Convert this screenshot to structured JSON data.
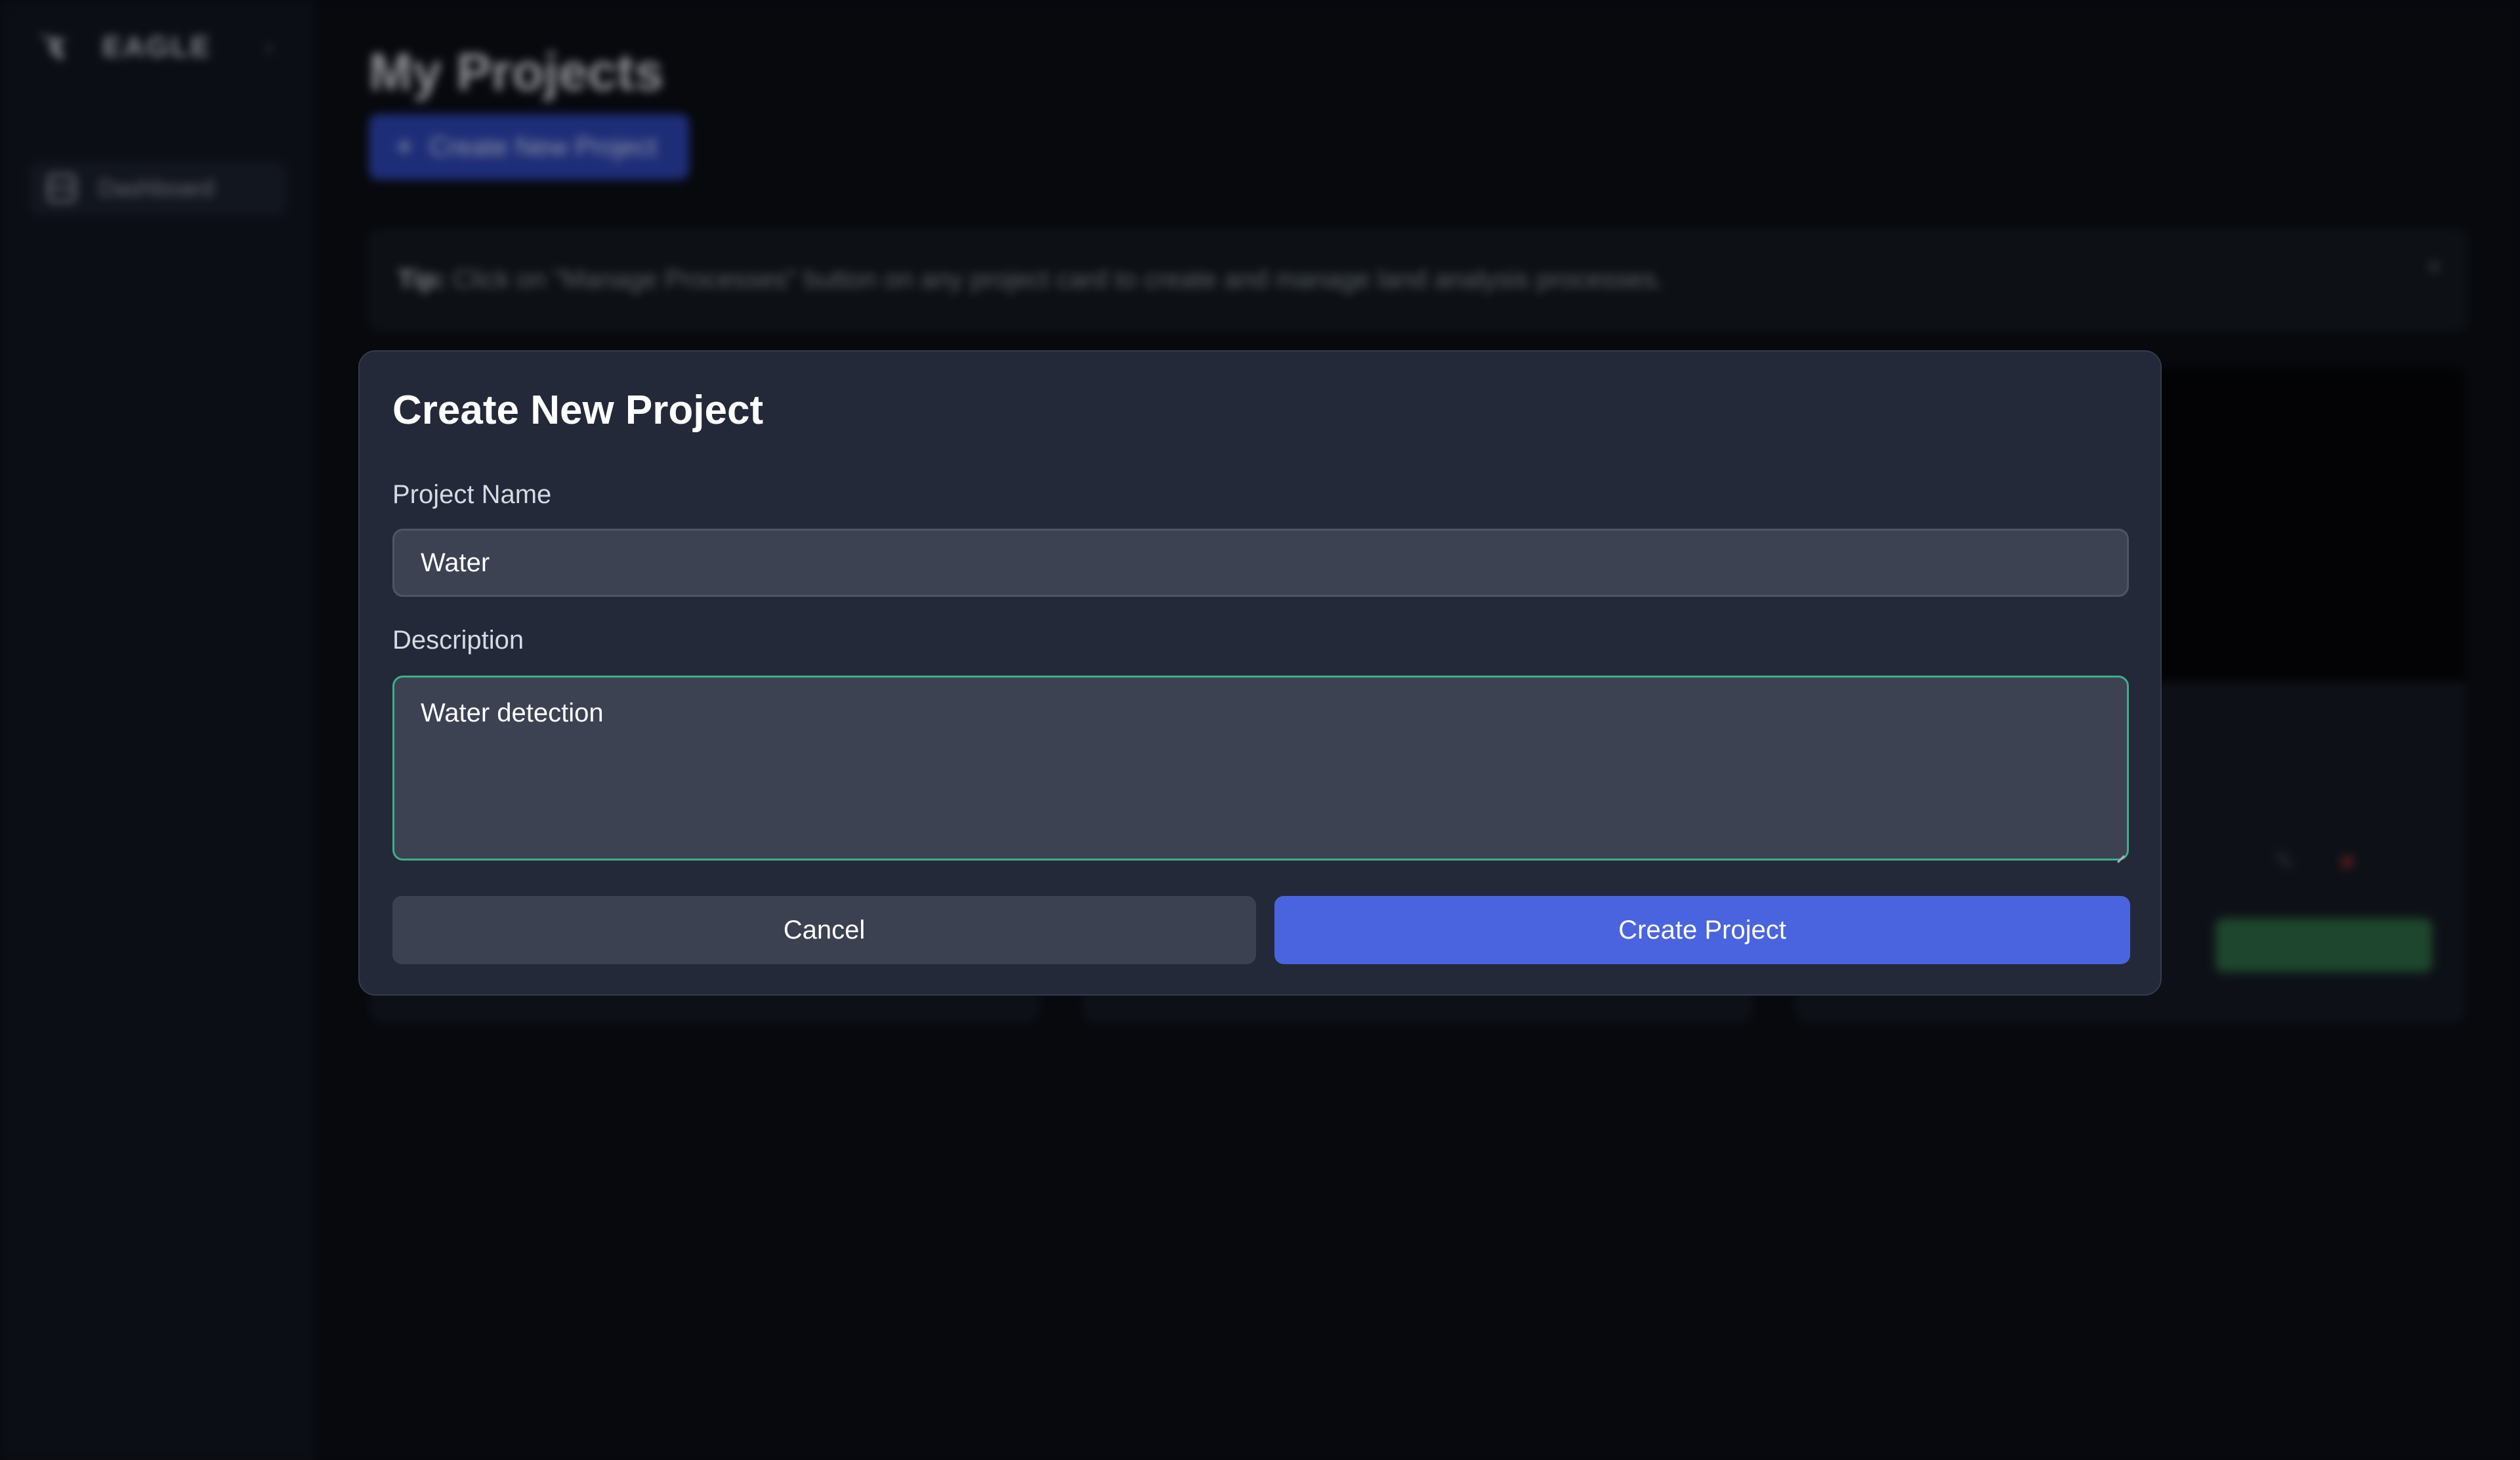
{
  "app": {
    "brand_name": "EAGLE",
    "colors": {
      "accent": "#4a64e0",
      "focus": "#3fae8a",
      "modal_bg": "#232938",
      "page_bg": "#0b0e15"
    }
  },
  "sidebar": {
    "collapse_icon": "chevron-left-icon",
    "items": [
      {
        "label": "Dashboard",
        "icon": "dashboard-icon"
      }
    ]
  },
  "main": {
    "title": "My Projects",
    "create_button_label": "Create New Project",
    "tip": {
      "prefix": "Tip:",
      "text": "Click on \"Manage Processes\" button on any project card to create and manage land analysis processes."
    }
  },
  "modal": {
    "title": "Create New Project",
    "project_name_label": "Project Name",
    "project_name_value": "Water",
    "description_label": "Description",
    "description_value": "Water detection",
    "cancel_label": "Cancel",
    "submit_label": "Create Project"
  }
}
